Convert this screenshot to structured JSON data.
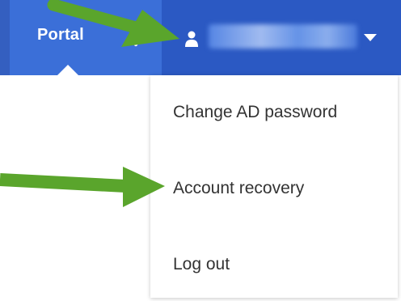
{
  "header": {
    "portal_label": "Portal",
    "bell_icon": "bell-icon",
    "user_icon": "user-icon",
    "dropdown_icon": "chevron-down-icon"
  },
  "menu": {
    "items": [
      {
        "label": "Change AD password"
      },
      {
        "label": "Account recovery"
      },
      {
        "label": "Log out"
      }
    ]
  },
  "colors": {
    "topbar": "#3b6fd8",
    "user_area": "#2b59c3",
    "menu_text": "#333333",
    "annotation_arrow": "#5aa52c"
  }
}
